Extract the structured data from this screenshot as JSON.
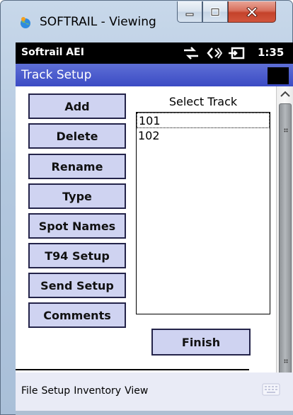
{
  "window": {
    "title": "SOFTRAIL - Viewing",
    "minimize_icon": "minimize-icon",
    "maximize_icon": "maximize-icon",
    "close_icon": "close-icon"
  },
  "device_status": {
    "app_name": "Softrail AEI",
    "time": "1:35",
    "icons": [
      "sync-icon",
      "speaker-icon",
      "battery-charging-icon"
    ]
  },
  "header": {
    "title": "Track Setup"
  },
  "commands": [
    {
      "label": "Add"
    },
    {
      "label": "Delete"
    },
    {
      "label": "Rename"
    },
    {
      "label": "Type"
    },
    {
      "label": "Spot Names"
    },
    {
      "label": "T94 Setup"
    },
    {
      "label": "Send Setup"
    },
    {
      "label": "Comments"
    }
  ],
  "track_list": {
    "title": "Select Track",
    "items": [
      "101",
      "102"
    ],
    "selected": "101"
  },
  "finish": {
    "label": "Finish"
  },
  "menu": {
    "items": [
      "File",
      "Setup",
      "Inventory",
      "View"
    ]
  },
  "colors": {
    "button_fill": "#cfd3f1",
    "button_border": "#24244a",
    "header_blue": "#3b4bc4",
    "menu_bg": "#e9ebf6"
  }
}
